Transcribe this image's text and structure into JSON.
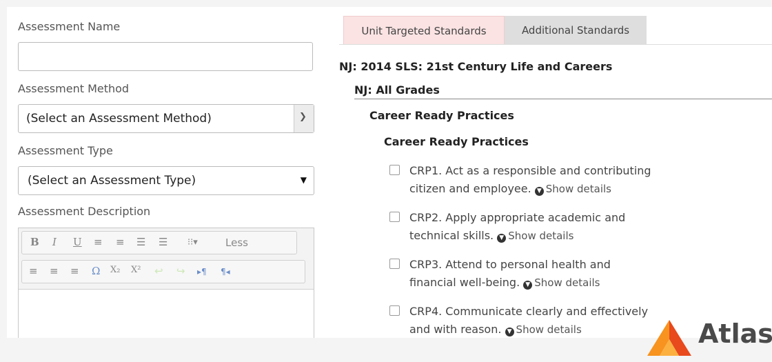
{
  "form": {
    "name_label": "Assessment Name",
    "name_value": "",
    "method_label": "Assessment Method",
    "method_value": "(Select an Assessment Method)",
    "type_label": "Assessment Type",
    "type_value": "(Select an Assessment Type)",
    "description_label": "Assessment Description"
  },
  "editor": {
    "row1": [
      "B",
      "I",
      "U",
      "≡",
      "≡",
      "☰",
      "☰",
      "⁝⁝▾",
      "Less"
    ],
    "row2": [
      "≡",
      "≡",
      "≡",
      "Ω",
      "X₂",
      "X²",
      "↩",
      "↪",
      "▸¶",
      "¶◂"
    ]
  },
  "tabs": [
    {
      "label": "Unit Targeted Standards",
      "active": true
    },
    {
      "label": "Additional Standards",
      "active": false
    }
  ],
  "standards": {
    "framework": "NJ: 2014 SLS: 21st Century Life and Careers",
    "grade": "NJ: All Grades",
    "category": "Career Ready Practices",
    "subcategory": "Career Ready Practices",
    "details_label": "Show details",
    "items": [
      {
        "line1": "CRP1. Act as a responsible and contributing",
        "line2": "citizen and employee."
      },
      {
        "line1": "CRP2. Apply appropriate academic and",
        "line2": "technical skills."
      },
      {
        "line1": "CRP3. Attend to personal health and",
        "line2": "financial well-being."
      },
      {
        "line1": "CRP4. Communicate clearly and effectively",
        "line2": "and with reason."
      }
    ]
  },
  "brand": {
    "name": "Atlas",
    "color_light": "#f7931e",
    "color_dark": "#e8491d"
  }
}
